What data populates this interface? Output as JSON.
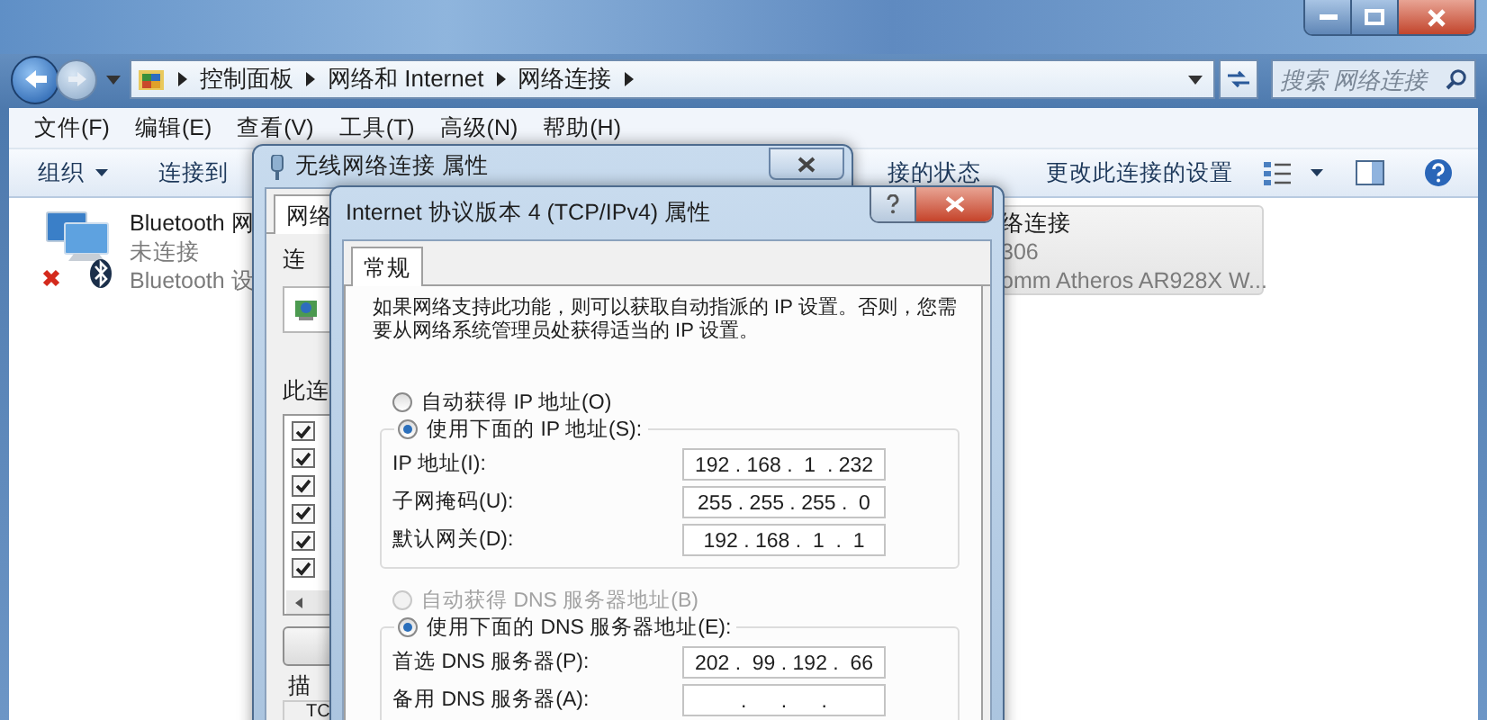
{
  "address_bar": {
    "breadcrumb": [
      "控制面板",
      "网络和 Internet",
      "网络连接"
    ]
  },
  "search": {
    "placeholder": "搜索 网络连接"
  },
  "menu": [
    "文件(F)",
    "编辑(E)",
    "查看(V)",
    "工具(T)",
    "高级(N)",
    "帮助(H)"
  ],
  "toolbar": [
    {
      "label": "组织",
      "dropdown": true
    },
    {
      "label": "连接到",
      "dropdown": false
    },
    {
      "label": "接的状态",
      "dropdown": false
    },
    {
      "label": "更改此连接的设置",
      "dropdown": false
    }
  ],
  "connections": [
    {
      "kind": "bluetooth",
      "name": "Bluetooth 网",
      "status": "未连接",
      "device": "Bluetooth 设",
      "selected": false
    },
    {
      "kind": "wireless",
      "name": "络连接",
      "status": "306",
      "device": "omm Atheros AR928X W...",
      "selected": true
    }
  ],
  "wireless_dialog": {
    "title": "无线网络连接 属性",
    "tab": {
      "label": "网络",
      "selected": true
    },
    "connect_label": "连",
    "items_label": "此连",
    "items": [
      {
        "checked": true
      },
      {
        "checked": true
      },
      {
        "checked": true
      },
      {
        "checked": true
      },
      {
        "checked": true
      },
      {
        "checked": true
      }
    ],
    "description_label": "描",
    "description": "TC"
  },
  "ipv4_dialog": {
    "title": "Internet 协议版本 4 (TCP/IPv4) 属性",
    "tab": {
      "label": "常规",
      "selected": true
    },
    "description": "如果网络支持此功能，则可以获取自动指派的 IP 设置。否则，您需要从网络系统管理员处获得适当的 IP 设置。",
    "ip": {
      "auto": {
        "label": "自动获得 IP 地址(O)",
        "selected": false,
        "disabled": false
      },
      "manual": {
        "label": "使用下面的 IP 地址(S):",
        "selected": true,
        "disabled": false
      },
      "fields": [
        {
          "label": "IP 地址(I):",
          "value": "192 . 168 .  1  . 232"
        },
        {
          "label": "子网掩码(U):",
          "value": "255 . 255 . 255 .  0"
        },
        {
          "label": "默认网关(D):",
          "value": "192 . 168 .  1  .  1"
        }
      ]
    },
    "dns": {
      "auto": {
        "label": "自动获得 DNS 服务器地址(B)",
        "selected": false,
        "disabled": true
      },
      "manual": {
        "label": "使用下面的 DNS 服务器地址(E):",
        "selected": true,
        "disabled": false
      },
      "fields": [
        {
          "label": "首选 DNS 服务器(P):",
          "value": "202 .  99 . 192 .  66"
        },
        {
          "label": "备用 DNS 服务器(A):",
          "value": "    .      .      .    "
        }
      ]
    }
  }
}
